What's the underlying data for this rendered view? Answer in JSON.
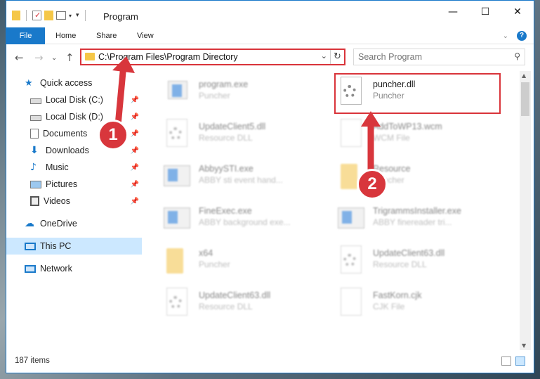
{
  "window": {
    "title": "Program"
  },
  "ribbon": {
    "tabs": [
      "File",
      "Home",
      "Share",
      "View"
    ]
  },
  "address": {
    "path": "C:\\Program Files\\Program Directory"
  },
  "search": {
    "placeholder": "Search Program"
  },
  "nav": {
    "items": [
      {
        "label": "Quick access",
        "icon": "star-icon"
      },
      {
        "label": "Local Disk (C:)",
        "icon": "drive-icon",
        "pinned": true
      },
      {
        "label": "Local Disk (D:)",
        "icon": "drive-icon",
        "pinned": true
      },
      {
        "label": "Documents",
        "icon": "documents-icon",
        "pinned": true
      },
      {
        "label": "Downloads",
        "icon": "download-icon",
        "pinned": true
      },
      {
        "label": "Music",
        "icon": "music-icon",
        "pinned": true
      },
      {
        "label": "Pictures",
        "icon": "pictures-icon",
        "pinned": true
      },
      {
        "label": "Videos",
        "icon": "videos-icon",
        "pinned": true
      },
      {
        "label": "OneDrive",
        "icon": "cloud-icon"
      },
      {
        "label": "This PC",
        "icon": "computer-icon",
        "selected": true
      },
      {
        "label": "Network",
        "icon": "network-icon"
      }
    ]
  },
  "files": [
    {
      "name": "program.exe",
      "desc": "Puncher",
      "icon": "exe-icon",
      "faded": true
    },
    {
      "name": "puncher.dll",
      "desc": "Puncher",
      "icon": "dll-gear-icon",
      "faded": false
    },
    {
      "name": "UpdateClient5.dll",
      "desc": "Resource DLL",
      "icon": "dll-gear-icon",
      "faded": true
    },
    {
      "name": "AddToWP13.wcm",
      "desc": "WCM File",
      "icon": "file-icon",
      "faded": true
    },
    {
      "name": "AbbyySTI.exe",
      "desc": "ABBY sti event hand...",
      "icon": "app-icon",
      "faded": true
    },
    {
      "name": "Resource",
      "desc": "Puncher",
      "icon": "folder-icon",
      "faded": true
    },
    {
      "name": "FineExec.exe",
      "desc": "ABBY background exe...",
      "icon": "app-icon",
      "faded": true
    },
    {
      "name": "TrigrammsInstaller.exe",
      "desc": "ABBY finereader tri...",
      "icon": "app-icon",
      "faded": true
    },
    {
      "name": "x64",
      "desc": "Puncher",
      "icon": "folder-icon",
      "faded": true
    },
    {
      "name": "UpdateClient63.dll",
      "desc": "Resource DLL",
      "icon": "dll-gear-icon",
      "faded": true
    },
    {
      "name": "UpdateClient63.dll",
      "desc": "Resource DLL",
      "icon": "dll-gear-icon",
      "faded": true
    },
    {
      "name": "FastKorn.cjk",
      "desc": "CJK File",
      "icon": "file-icon",
      "faded": true
    }
  ],
  "status": {
    "count": "187 items"
  },
  "annotations": {
    "step1": "1",
    "step2": "2",
    "color": "#d8363c"
  }
}
